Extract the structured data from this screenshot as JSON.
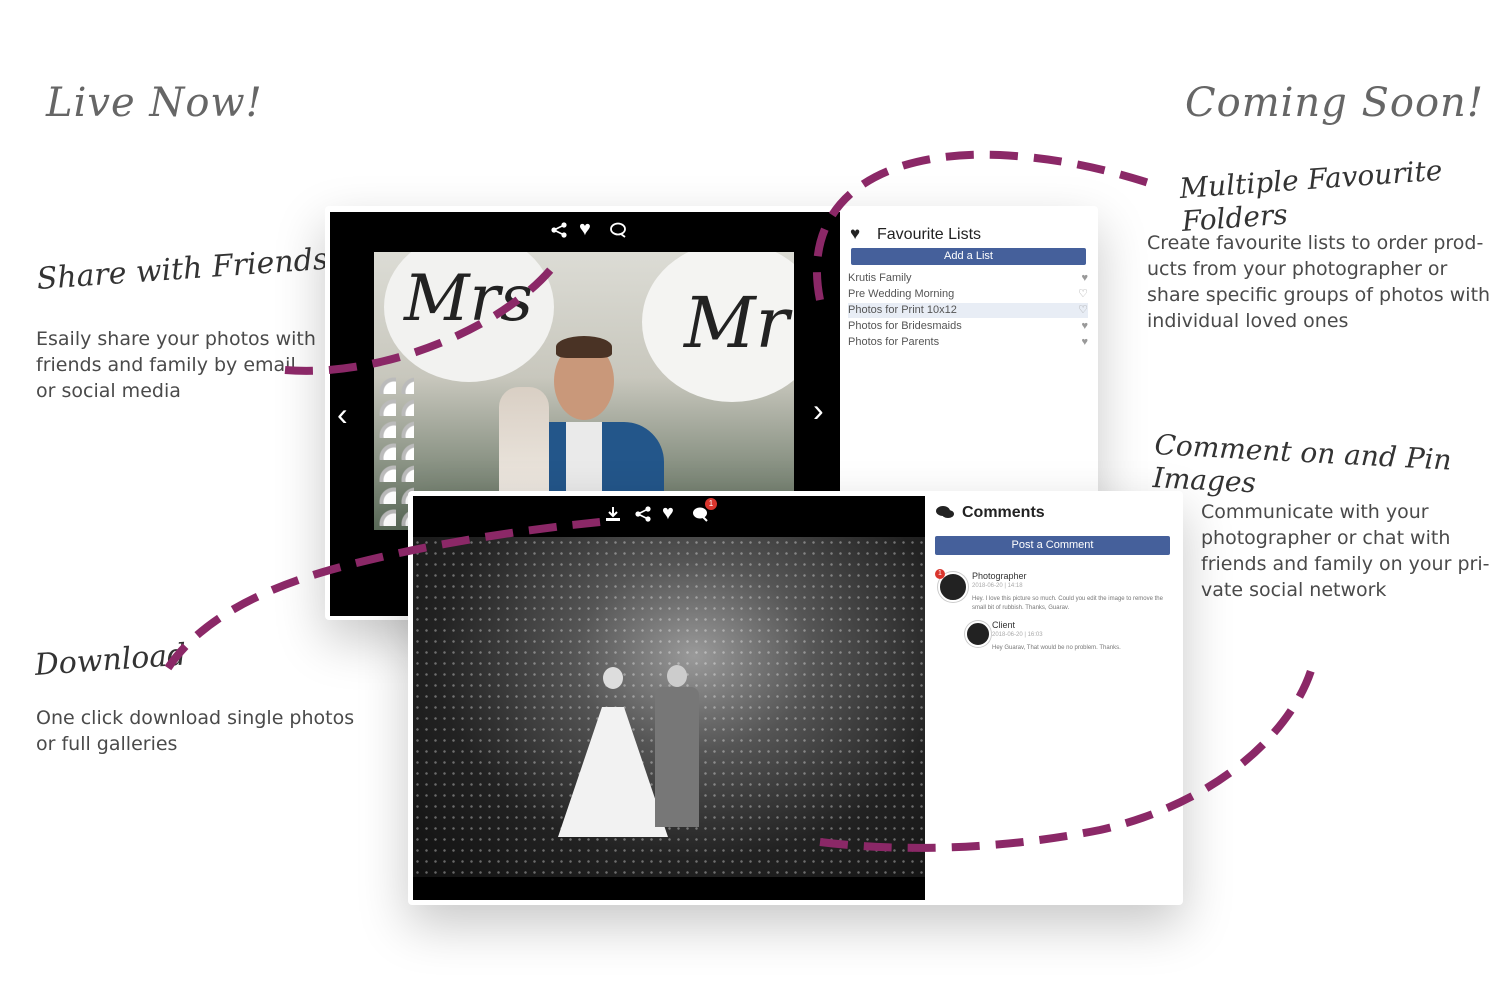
{
  "headings": {
    "live": "Live Now!",
    "coming": "Coming Soon!"
  },
  "features": {
    "share": {
      "title": "Share with Friends",
      "lines": [
        "Esaily share your photos with",
        "friends and family by email",
        "or social media"
      ]
    },
    "download": {
      "title": "Download",
      "lines": [
        "One click download single photos",
        "or full galleries"
      ]
    },
    "favourites": {
      "title": "Multiple Favourite Folders",
      "lines": [
        "Create favourite lists to order prod-",
        "ucts from your photographer or",
        "share specific groups of photos with",
        "individual loved ones"
      ]
    },
    "comment": {
      "title": "Comment on and Pin Images",
      "lines": [
        "Communicate with your",
        "photographer or chat with",
        "friends and family on your pri-",
        "vate social network"
      ]
    }
  },
  "favourites_panel": {
    "title": "Favourite Lists",
    "add_button": "Add a List",
    "items": [
      "Krutis Family",
      "Pre Wedding Morning",
      "Photos for Print 10x12",
      "Photos for Bridesmaids",
      "Photos for Parents"
    ],
    "photo_balloons": {
      "left": "Mrs",
      "right": "Mr"
    }
  },
  "comments_panel": {
    "title": "Comments",
    "post_button": "Post a Comment",
    "badge_count": "1",
    "pin_count": "1",
    "entries": [
      {
        "name": "Photographer",
        "meta": "2018-06-20 | 14:18",
        "text_lines": [
          "Hey. I love this picture so much. Could you edit the image to remove the",
          "small bit of rubbish. Thanks, Guarav."
        ]
      },
      {
        "name": "Client",
        "meta": "2018-06-20 | 16:03",
        "text_lines": [
          "Hey Guarav, That would be no problem. Thanks."
        ]
      }
    ]
  },
  "colors": {
    "accent": "#8b2867",
    "button": "#45609b"
  },
  "icons": [
    "share-icon",
    "heart-icon",
    "comment-icon",
    "download-icon",
    "chevron-left-icon",
    "chevron-right-icon"
  ]
}
